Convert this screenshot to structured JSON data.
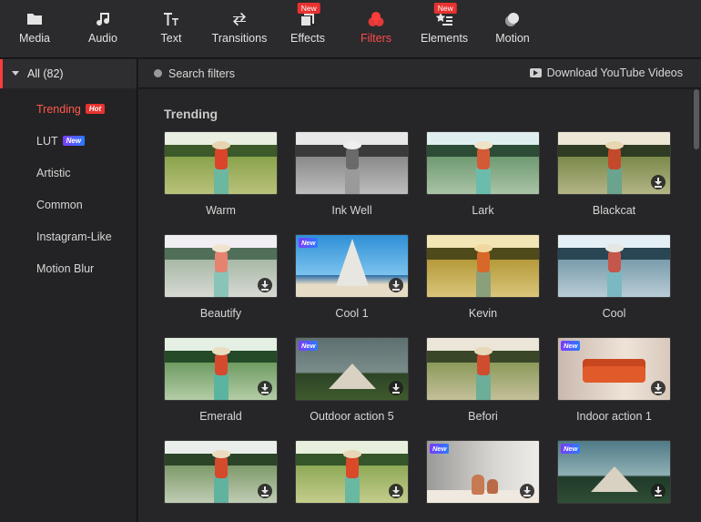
{
  "toolbar": {
    "items": [
      {
        "label": "Media",
        "icon": "folder-icon"
      },
      {
        "label": "Audio",
        "icon": "music-note-icon"
      },
      {
        "label": "Text",
        "icon": "text-icon"
      },
      {
        "label": "Transitions",
        "icon": "swap-arrows-icon"
      },
      {
        "label": "Effects",
        "icon": "effects-icon",
        "badge": "New"
      },
      {
        "label": "Filters",
        "icon": "filters-icon",
        "active": true
      },
      {
        "label": "Elements",
        "icon": "elements-icon",
        "badge": "New"
      },
      {
        "label": "Motion",
        "icon": "motion-icon"
      }
    ],
    "active_color": "#ff4a4a"
  },
  "sidebar": {
    "all_label": "All (82)",
    "items": [
      {
        "label": "Trending",
        "tag": "Hot",
        "active": true
      },
      {
        "label": "LUT",
        "tag": "New"
      },
      {
        "label": "Artistic"
      },
      {
        "label": "Common"
      },
      {
        "label": "Instagram-Like"
      },
      {
        "label": "Motion Blur"
      }
    ]
  },
  "search": {
    "placeholder": "Search filters",
    "download_label": "Download YouTube Videos"
  },
  "content": {
    "section_title": "Trending",
    "cards": [
      {
        "label": "Warm",
        "style": "warm",
        "download": false,
        "new": false
      },
      {
        "label": "Ink Well",
        "style": "bw",
        "download": false,
        "new": false
      },
      {
        "label": "Lark",
        "style": "lark",
        "download": false,
        "new": false
      },
      {
        "label": "Blackcat",
        "style": "blackcat",
        "download": true,
        "new": false
      },
      {
        "label": "Beautify",
        "style": "beautify",
        "download": true,
        "new": false
      },
      {
        "label": "Cool 1",
        "style": "cool1",
        "download": true,
        "new": true
      },
      {
        "label": "Kevin",
        "style": "kevin",
        "download": false,
        "new": false
      },
      {
        "label": "Cool",
        "style": "cool",
        "download": false,
        "new": false
      },
      {
        "label": "Emerald",
        "style": "emerald",
        "download": true,
        "new": false
      },
      {
        "label": "Outdoor action 5",
        "style": "outdoor",
        "download": true,
        "new": true
      },
      {
        "label": "Befori",
        "style": "befori",
        "download": false,
        "new": false
      },
      {
        "label": "Indoor action 1",
        "style": "indoor",
        "download": true,
        "new": true
      },
      {
        "label": "",
        "style": "row4a",
        "download": true,
        "new": false
      },
      {
        "label": "",
        "style": "row4b",
        "download": true,
        "new": false
      },
      {
        "label": "",
        "style": "vase",
        "download": true,
        "new": true
      },
      {
        "label": "",
        "style": "tent2",
        "download": true,
        "new": true
      }
    ]
  }
}
